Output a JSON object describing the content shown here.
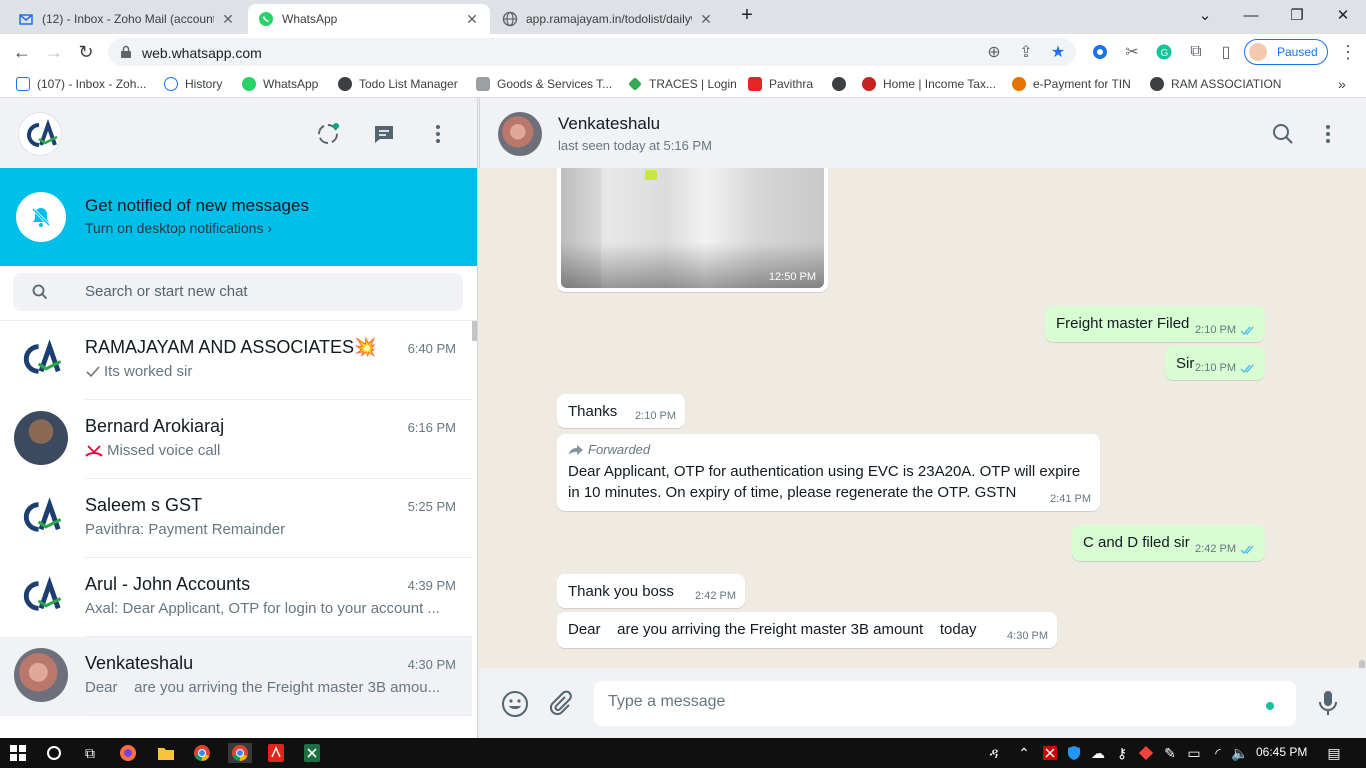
{
  "browser": {
    "tabs": [
      {
        "title": "(12) - Inbox - Zoho Mail (account",
        "active": false
      },
      {
        "title": "WhatsApp",
        "active": true
      },
      {
        "title": "app.ramajayam.in/todolist/dailyw",
        "active": false
      }
    ],
    "url": "web.whatsapp.com",
    "profile_status": "Paused",
    "bookmarks": [
      {
        "label": "(107) - Inbox - Zoh...",
        "icon": "zoho-mail-icon"
      },
      {
        "label": "History",
        "icon": "history-icon"
      },
      {
        "label": "WhatsApp",
        "icon": "whatsapp-icon"
      },
      {
        "label": "Todo List Manager",
        "icon": "globe-icon"
      },
      {
        "label": "Goods & Services T...",
        "icon": "gst-emblem-icon"
      },
      {
        "label": "TRACES | Login",
        "icon": "traces-icon"
      },
      {
        "label": "Pavithra",
        "icon": "zoho-z-icon"
      },
      {
        "label": "",
        "icon": "globe-icon"
      },
      {
        "label": "Home | Income Tax...",
        "icon": "income-tax-icon"
      },
      {
        "label": "e-Payment for TIN",
        "icon": "tin-icon"
      },
      {
        "label": "RAM ASSOCIATION",
        "icon": "globe-icon"
      }
    ]
  },
  "notification": {
    "title": "Get notified of new messages",
    "subtitle": "Turn on desktop notifications ›"
  },
  "search": {
    "placeholder": "Search or start new chat"
  },
  "chats": [
    {
      "name": "RAMAJAYAM AND ASSOCIATES💥",
      "time": "6:40 PM",
      "preview": "Its worked sir",
      "avatar": "ca-logo"
    },
    {
      "name": "Bernard Arokiaraj",
      "time": "6:16 PM",
      "preview": "Missed voice call",
      "avatar": "photo"
    },
    {
      "name": "Saleem s GST",
      "time": "5:25 PM",
      "preview": "Pavithra: Payment Remainder",
      "avatar": "ca-logo"
    },
    {
      "name": "Arul - John  Accounts",
      "time": "4:39 PM",
      "preview": "Axal: Dear Applicant, OTP for login to your account ...",
      "avatar": "ca-logo"
    },
    {
      "name": "Venkateshalu",
      "time": "4:30 PM",
      "preview": "Dear    are you arriving the Freight master 3B amou...",
      "avatar": "photo"
    }
  ],
  "conversation": {
    "contact": "Venkateshalu",
    "status": "last seen today at 5:16 PM",
    "image_time": "12:50 PM",
    "messages": [
      {
        "dir": "out",
        "text": "Freight master Filed",
        "time": "2:10 PM"
      },
      {
        "dir": "out",
        "text": "Sir",
        "time": "2:10 PM"
      },
      {
        "dir": "in",
        "text": "Thanks",
        "time": "2:10 PM"
      },
      {
        "dir": "in",
        "forwarded": "Forwarded",
        "line1": "Dear Applicant, OTP for authentication using EVC is 23A20A. OTP will expire",
        "line2": "in 10 minutes. On expiry of time, please regenerate the OTP. GSTN",
        "time": "2:41 PM"
      },
      {
        "dir": "out",
        "text": "C and D filed sir",
        "time": "2:42 PM"
      },
      {
        "dir": "in",
        "text": "Thank you boss",
        "time": "2:42 PM"
      },
      {
        "dir": "in",
        "text": "Dear    are you arriving the Freight master 3B amount    today",
        "time": "4:30 PM"
      }
    ]
  },
  "composer": {
    "placeholder": "Type a message"
  },
  "taskbar": {
    "clock": "06:45 PM"
  },
  "colors": {
    "notif_bar": "#00bfe9",
    "outgoing_bubble": "#d9fdd3",
    "tick_read": "#53bdeb",
    "missed_call": "#ea0038"
  }
}
